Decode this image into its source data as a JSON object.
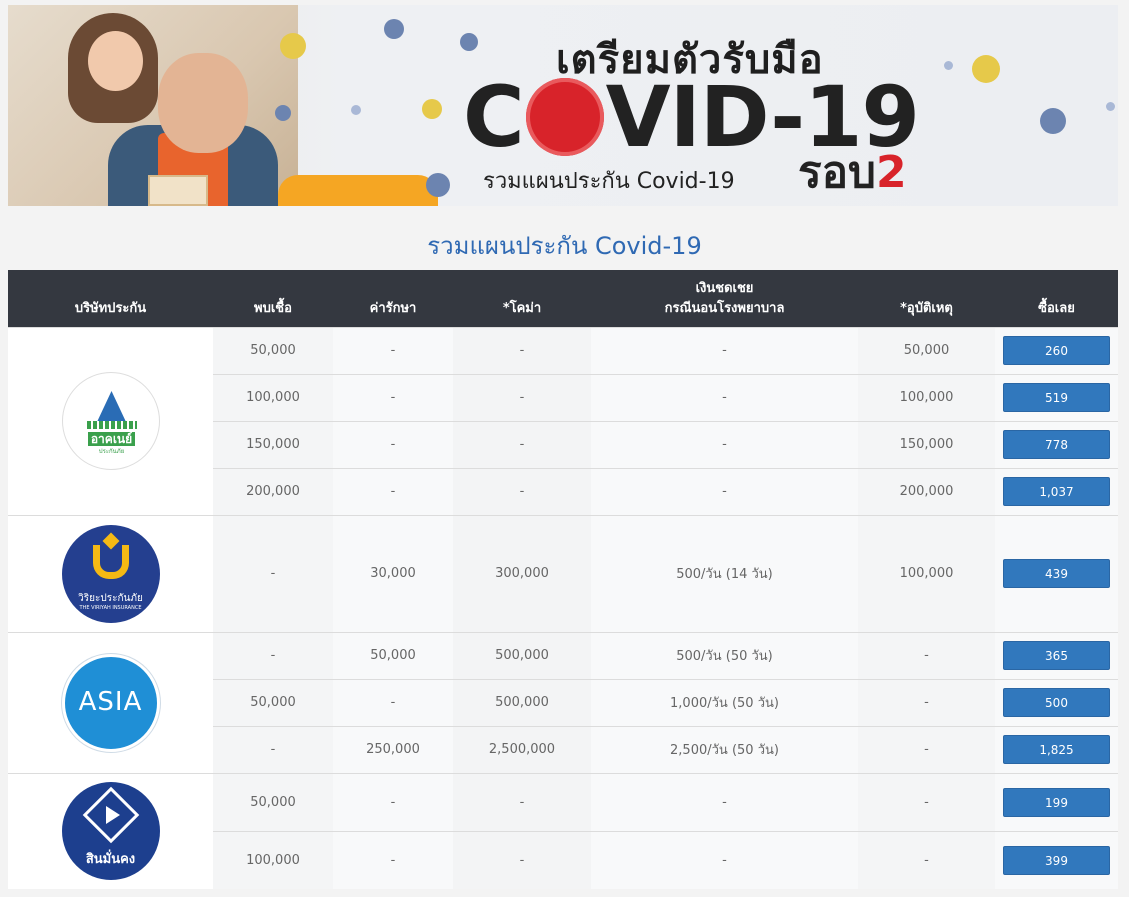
{
  "banner": {
    "heading": "เตรียมตัวรับมือ",
    "covid_pre": "C",
    "covid_post": "VID-19",
    "subtitle": "รวมแผนประกัน Covid-19",
    "round_label": "รอบ",
    "round_number": "2"
  },
  "section_title": "รวมแผนประกัน  Covid-19",
  "table": {
    "headers": {
      "company": "บริษัทประกัน",
      "found": "พบเชื้อ",
      "treatment": "ค่ารักษา",
      "coma": "*โคม่า",
      "hospital_line1": "เงินชดเชย",
      "hospital_line2": "กรณีนอนโรงพยาบาล",
      "accident": "*อุบัติเหตุ",
      "buy": "ซื้อเลย"
    },
    "companies": [
      {
        "logo_icon": "aken-logo",
        "logo_text": "อาคเนย์",
        "logo_subtext": "ประกันภัย",
        "plans": [
          {
            "found": "50,000",
            "treatment": "-",
            "coma": "-",
            "hospital": "-",
            "accident": "50,000",
            "price": "260"
          },
          {
            "found": "100,000",
            "treatment": "-",
            "coma": "-",
            "hospital": "-",
            "accident": "100,000",
            "price": "519"
          },
          {
            "found": "150,000",
            "treatment": "-",
            "coma": "-",
            "hospital": "-",
            "accident": "150,000",
            "price": "778"
          },
          {
            "found": "200,000",
            "treatment": "-",
            "coma": "-",
            "hospital": "-",
            "accident": "200,000",
            "price": "1,037"
          }
        ]
      },
      {
        "logo_icon": "viriyah-logo",
        "logo_text": "วิริยะประกันภัย",
        "logo_subtext": "THE VIRIYAH INSURANCE",
        "plans": [
          {
            "found": "-",
            "treatment": "30,000",
            "coma": "300,000",
            "hospital": "500/วัน (14 วัน)",
            "accident": "100,000",
            "price": "439"
          }
        ]
      },
      {
        "logo_icon": "asia-logo",
        "logo_text": "ASIA",
        "plans": [
          {
            "found": "-",
            "treatment": "50,000",
            "coma": "500,000",
            "hospital": "500/วัน (50 วัน)",
            "accident": "-",
            "price": "365"
          },
          {
            "found": "50,000",
            "treatment": "-",
            "coma": "500,000",
            "hospital": "1,000/วัน (50 วัน)",
            "accident": "-",
            "price": "500"
          },
          {
            "found": "-",
            "treatment": "250,000",
            "coma": "2,500,000",
            "hospital": "2,500/วัน (50 วัน)",
            "accident": "-",
            "price": "1,825"
          }
        ]
      },
      {
        "logo_icon": "sinmun-logo",
        "logo_text": "สินมั่นคง",
        "plans": [
          {
            "found": "50,000",
            "treatment": "-",
            "coma": "-",
            "hospital": "-",
            "accident": "-",
            "price": "199"
          },
          {
            "found": "100,000",
            "treatment": "-",
            "coma": "-",
            "hospital": "-",
            "accident": "-",
            "price": "399"
          }
        ]
      }
    ]
  }
}
